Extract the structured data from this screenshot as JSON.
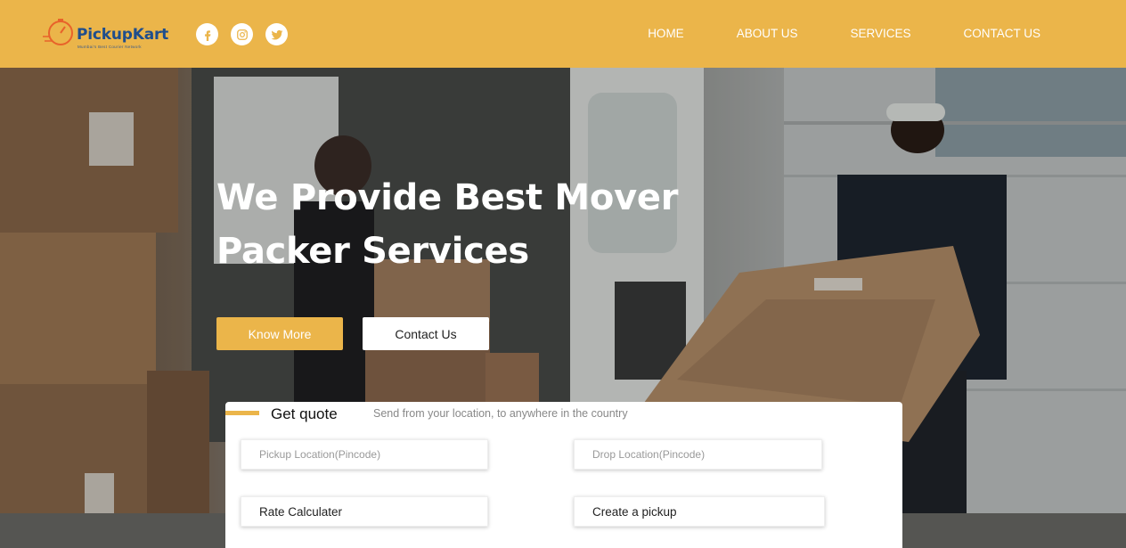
{
  "brand": {
    "name": "PickupKart",
    "tagline": "Mumbai's Best Courier Network",
    "accent_color": "#EBB54A",
    "logo_text_color": "#1F4E8C"
  },
  "social": [
    {
      "icon": "facebook-icon"
    },
    {
      "icon": "instagram-icon"
    },
    {
      "icon": "twitter-icon"
    }
  ],
  "nav": {
    "items": [
      {
        "label": "HOME"
      },
      {
        "label": "ABOUT US"
      },
      {
        "label": "SERVICES"
      },
      {
        "label": "CONTACT US"
      }
    ]
  },
  "hero": {
    "title_line1": "We Provide Best Mover",
    "title_line2": "Packer Services",
    "know_more_label": "Know More",
    "contact_label": "Contact Us"
  },
  "quote": {
    "title": "Get quote",
    "subtitle": "Send from your location, to anywhere in the country",
    "pickup_placeholder": "Pickup Location(Pincode)",
    "drop_placeholder": "Drop Location(Pincode)",
    "rate_label": "Rate Calculater",
    "create_label": "Create a pickup"
  }
}
